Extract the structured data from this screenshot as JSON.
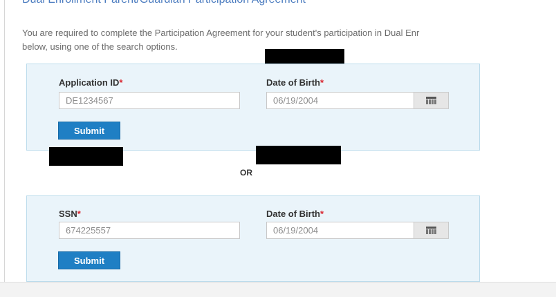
{
  "page": {
    "heading": "Dual Enrollment Parent/Guardian Participation Agreement",
    "intro_line1": "You are required to complete the Participation Agreement for your student's participation in Dual Enr",
    "intro_line2": "below, using one of the search options.",
    "or_label": "OR",
    "required_mark": "*"
  },
  "form1": {
    "id_label": "Application ID",
    "id_value": "DE1234567",
    "dob_label": "Date of Birth",
    "dob_value": "06/19/2004",
    "submit_label": "Submit"
  },
  "form2": {
    "ssn_label": "SSN",
    "ssn_value": "674225557",
    "dob_label": "Date of Birth",
    "dob_value": "06/19/2004",
    "submit_label": "Submit"
  },
  "icons": [
    "calendar-icon"
  ],
  "colors": {
    "panel_bg": "#eaf4fa",
    "panel_border": "#bcdcec",
    "button": "#1f7fc4",
    "required": "#d9232d",
    "heading": "#4a7bbf"
  }
}
